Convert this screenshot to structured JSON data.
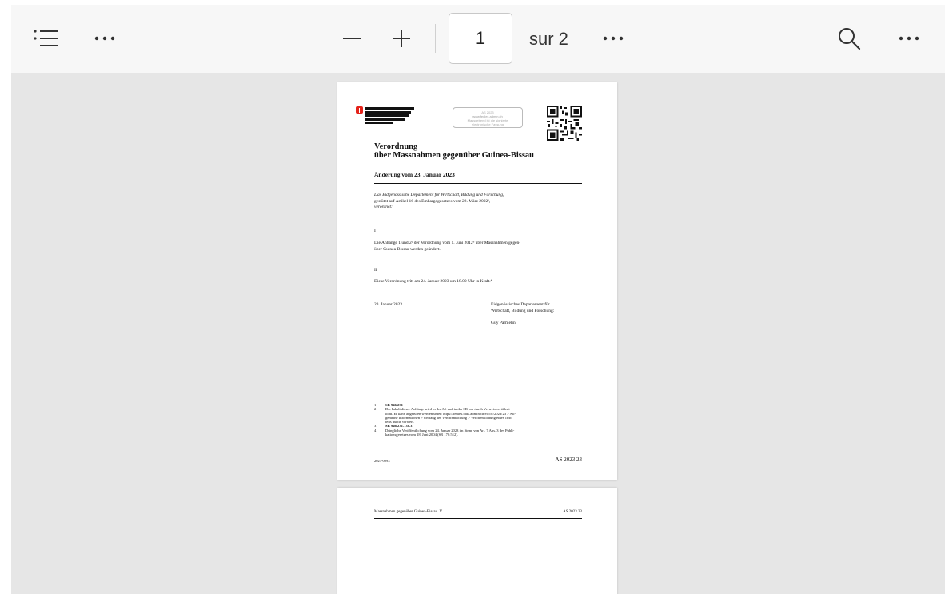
{
  "toolbar": {
    "icons": {
      "contents": "list-icon",
      "more_left": "more-horizontal-icon",
      "zoom_out": "minus-icon",
      "zoom_in": "plus-icon",
      "more_mid": "more-horizontal-icon",
      "search": "search-icon",
      "more_right": "more-horizontal-icon"
    },
    "current_page": "1",
    "page_total": "sur 2"
  },
  "document": {
    "page1": {
      "stamp_lines": [
        "AS 2023",
        "www.fedlex.admin.ch",
        "Massgebend ist die signierte",
        "elektronische Fassung"
      ],
      "title_line1": "Verordnung",
      "title_line2": "über Massnahmen gegenüber Guinea-Bissau",
      "amendment": "Änderung vom 23. Januar 2023",
      "preamble_line1": "Das Eidgenössische Departement für Wirtschaft, Bildung und Forschung,",
      "preamble_line2": "gestützt auf Artikel 16 des Embargogesetzes vom 22. März 2002¹,",
      "preamble_line3": "verordnet:",
      "sec1_num": "I",
      "sec1_line1": "Die Anhänge 1 und 2² der Verordnung vom 1. Juni 2012³ über Massnahmen gegen-",
      "sec1_line2": "über Guinea-Bissau werden geändert.",
      "sec2_num": "II",
      "sec2_line1": "Diese Verordnung tritt am 24. Januar 2023 um 18.00 Uhr in Kraft.⁴",
      "date": "23. Januar 2023",
      "dept_line1": "Eidgenössisches Departement für",
      "dept_line2": "Wirtschaft, Bildung und Forschung:",
      "signatory": "Guy Parmelin",
      "footnotes": [
        {
          "n": "1",
          "text": "SR 946.231"
        },
        {
          "n": "2",
          "text": "Der Inhalt dieser Anhänge wird in der AS und in der SR nur durch Verweis veröffent-"
        },
        {
          "n": "",
          "text": "licht. Er kann abgerufen werden unter: https://fedlex.data.admin.ch/eli/oc/2023/23 > All-"
        },
        {
          "n": "",
          "text": "gemeine Informationen > Umfang der Veröffentlichung > Veröffentlichung eines Text-"
        },
        {
          "n": "",
          "text": "teils durch Verweis."
        },
        {
          "n": "3",
          "text": "SR 946.231.138.3"
        },
        {
          "n": "4",
          "text": "Dringliche Veröffentlichung vom 24. Januar 2023 im Sinne von Art. 7 Abs. 3 des Publi-"
        },
        {
          "n": "",
          "text": "kationsgesetzes vom 18. Juni 2004 (SR 170.512)."
        }
      ],
      "footer_left": "2023-0093",
      "footer_right": "AS 2023 23"
    },
    "page2": {
      "header_left": "Massnahmen gegenüber Guinea-Bissau. V",
      "header_right": "AS 2023 23"
    }
  }
}
